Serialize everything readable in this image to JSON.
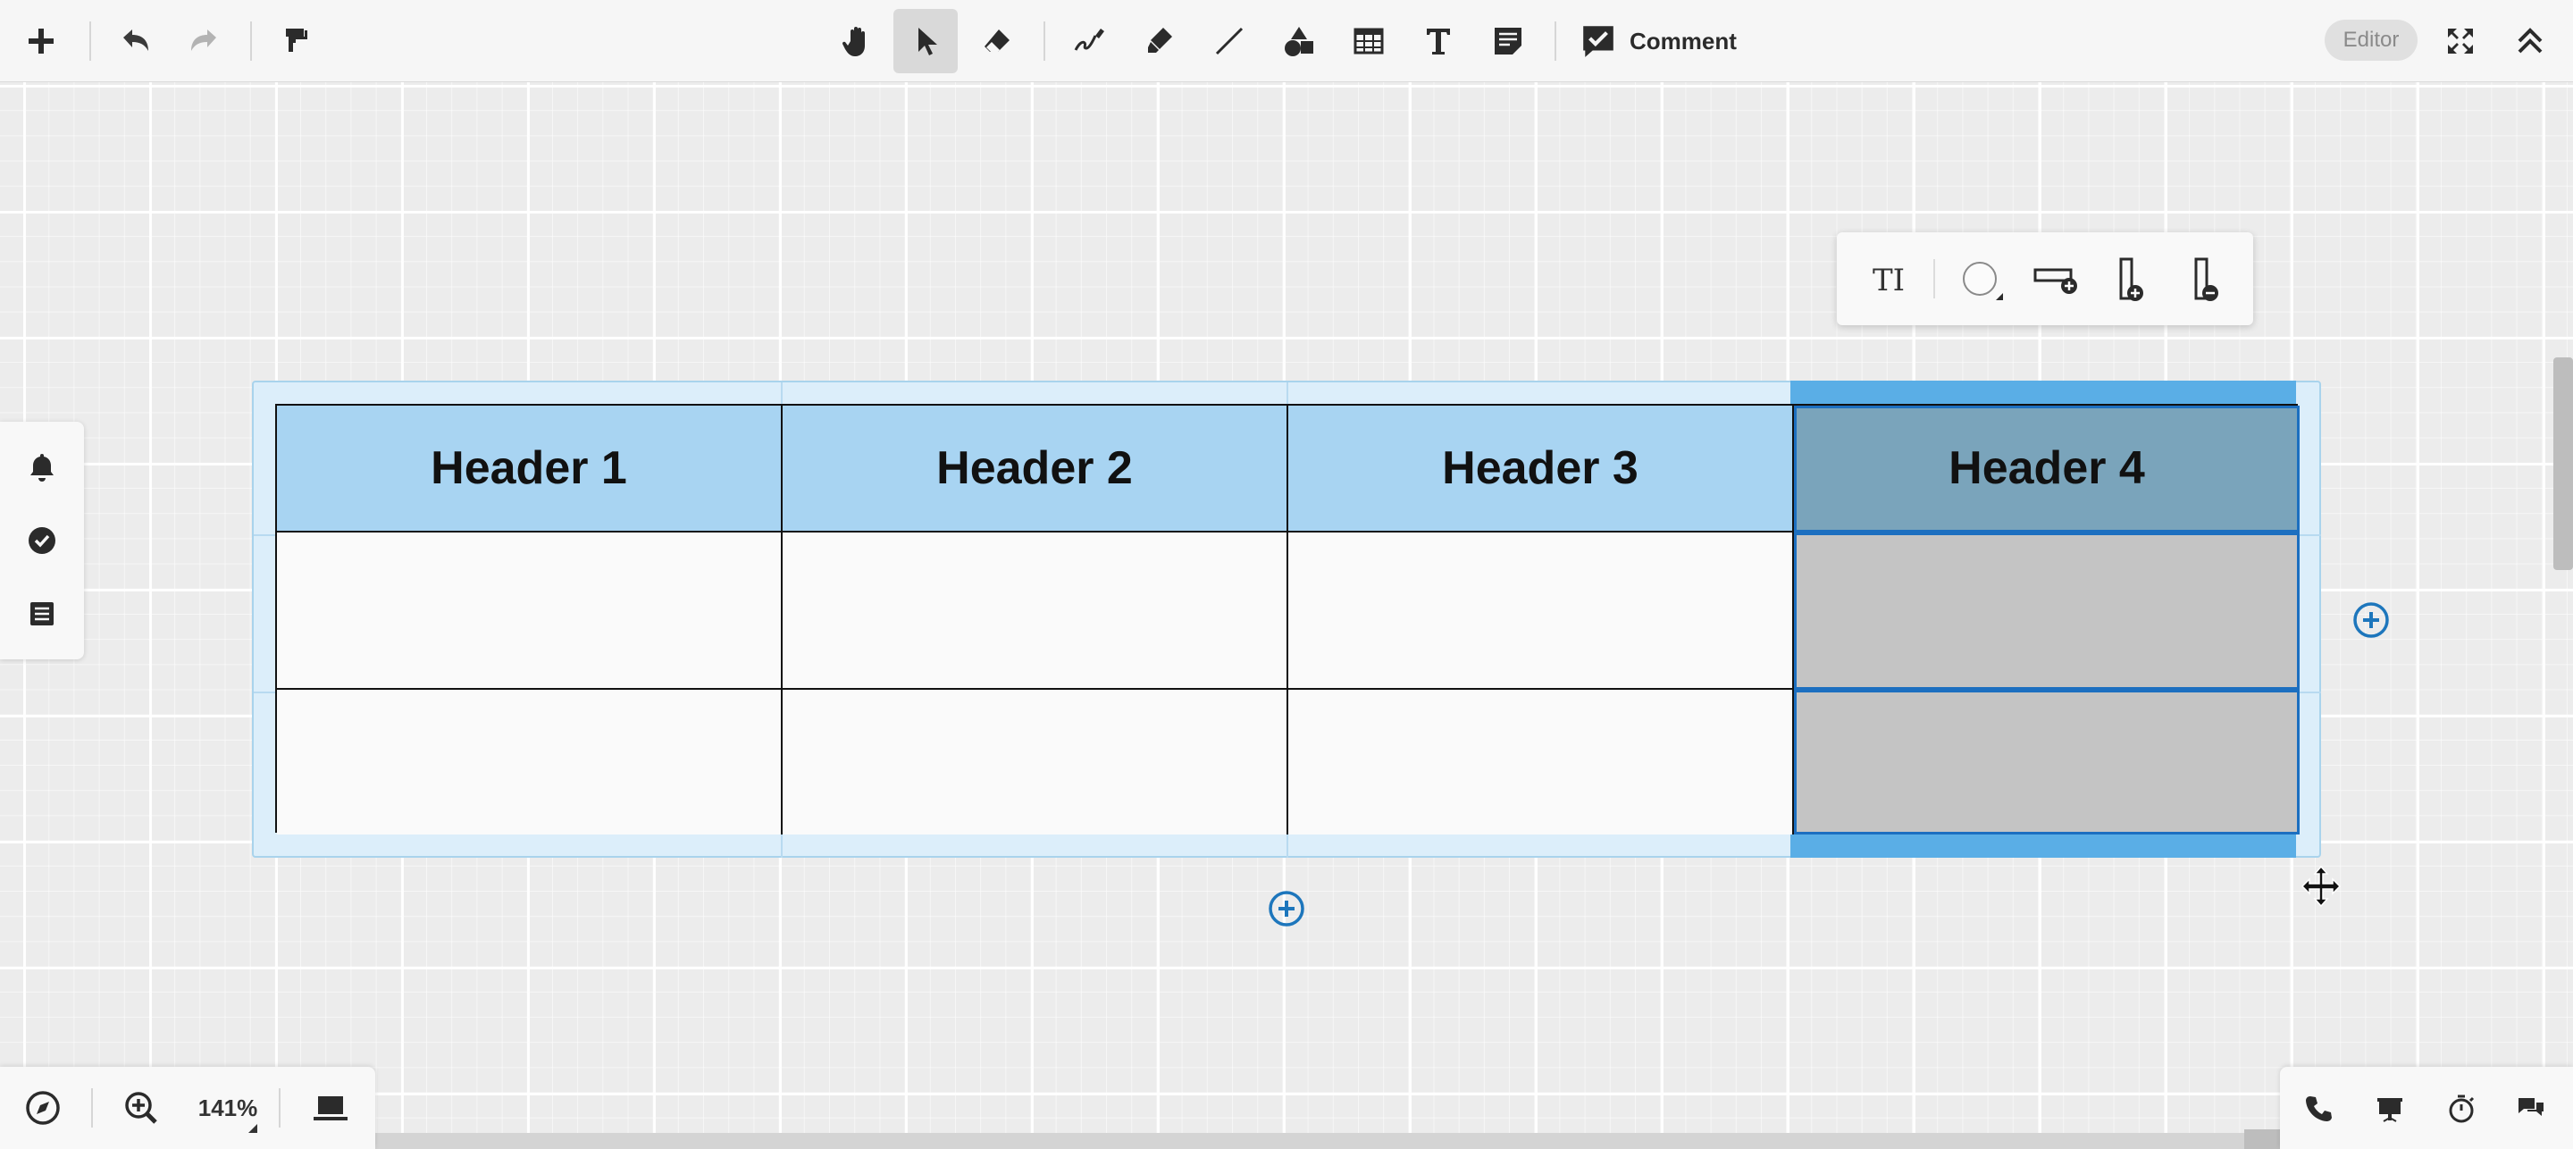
{
  "toolbar": {
    "items": [
      {
        "id": "add",
        "icon": "plus-icon"
      },
      {
        "id": "undo",
        "icon": "undo-icon"
      },
      {
        "id": "redo",
        "icon": "redo-icon",
        "disabled": true
      },
      {
        "id": "format-painter",
        "icon": "paint-roller-icon"
      },
      {
        "id": "hand",
        "icon": "hand-icon"
      },
      {
        "id": "select",
        "icon": "pointer-icon",
        "active": true
      },
      {
        "id": "eraser",
        "icon": "eraser-icon"
      },
      {
        "id": "pen",
        "icon": "pen-icon"
      },
      {
        "id": "highlighter",
        "icon": "highlighter-icon"
      },
      {
        "id": "line",
        "icon": "line-icon"
      },
      {
        "id": "shapes",
        "icon": "shapes-icon"
      },
      {
        "id": "table",
        "icon": "table-icon"
      },
      {
        "id": "text",
        "icon": "text-icon"
      },
      {
        "id": "sticky-note",
        "icon": "sticky-note-icon"
      }
    ],
    "comment_label": "Comment",
    "editor_badge": "Editor",
    "fullscreen_icon": "fullscreen-icon",
    "collapse_icon": "collapse-up-icon"
  },
  "context_toolbar": {
    "text_format_label": "TI",
    "items": [
      "text-format-icon",
      "fill-color-icon",
      "add-row-icon",
      "add-column-icon",
      "remove-column-icon"
    ]
  },
  "table": {
    "headers": [
      "Header 1",
      "Header 2",
      "Header 3",
      "Header 4"
    ],
    "rows": [
      [
        "",
        "",
        "",
        ""
      ],
      [
        "",
        "",
        "",
        ""
      ]
    ],
    "selected_column": 4
  },
  "left_panel": {
    "items": [
      "bell-icon",
      "check-circle-icon",
      "list-icon"
    ]
  },
  "bottom_left": {
    "zoom_label": "141%",
    "items": [
      "compass-icon",
      "zoom-in-icon",
      "laptop-icon"
    ]
  },
  "bottom_right": {
    "items": [
      "phone-icon",
      "presentation-icon",
      "timer-icon",
      "chat-icon"
    ]
  },
  "colors": {
    "header_bg": "#a8d4f2",
    "selection": "#1c6fc0",
    "frame_bg": "#dceefa",
    "accent": "#1d76bc"
  }
}
